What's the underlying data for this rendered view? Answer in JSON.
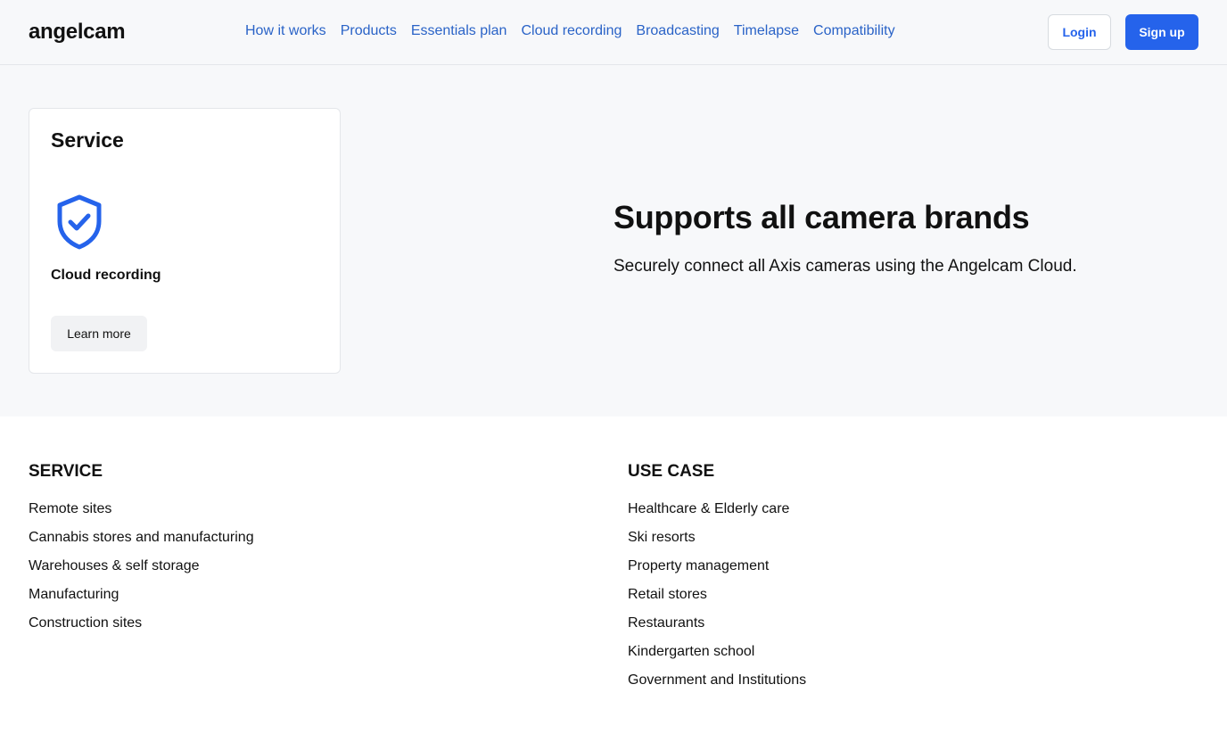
{
  "header": {
    "logo": "angelcam",
    "nav": [
      "How it works",
      "Products",
      "Essentials plan",
      "Cloud recording",
      "Broadcasting",
      "Timelapse",
      "Compatibility"
    ],
    "login_label": "Login",
    "signup_label": "Sign up"
  },
  "card": {
    "title": "Service",
    "icon": "shield-check-icon",
    "item": "Cloud recording",
    "button_label": "Learn more"
  },
  "hero": {
    "title": "Supports all camera brands",
    "text": "Securely connect all Axis cameras using the Angelcam Cloud."
  },
  "footer": {
    "service": {
      "title": "SERVICE",
      "items": [
        "Remote sites",
        "Cannabis stores and manufacturing",
        "Warehouses & self storage",
        "Manufacturing",
        "Construction sites"
      ]
    },
    "use_case": {
      "title": "USE CASE",
      "items": [
        "Healthcare & Elderly care",
        "Ski resorts",
        "Property management",
        "Retail stores",
        "Restaurants",
        "Kindergarten school",
        "Government and Institutions"
      ]
    }
  },
  "colors": {
    "accent": "#2563eb",
    "nav_link": "#2a63c7",
    "hero_bg": "#f7f8fa"
  }
}
